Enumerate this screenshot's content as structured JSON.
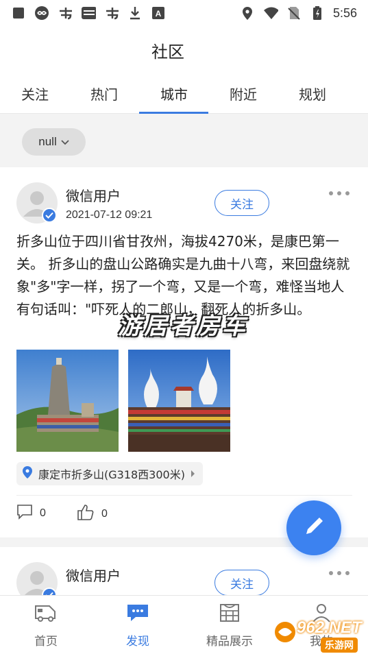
{
  "status_bar": {
    "time": "5:56",
    "left_icons": [
      "square-icon",
      "infinity-badge-icon",
      "app-icon",
      "news-app-icon",
      "app-icon",
      "download-icon",
      "text-a-icon"
    ],
    "right_icons": [
      "location-icon",
      "wifi-icon",
      "no-sim-icon",
      "battery-charging-icon"
    ]
  },
  "header": {
    "title": "社区"
  },
  "tabs": [
    {
      "label": "关注"
    },
    {
      "label": "热门"
    },
    {
      "label": "城市",
      "active": true
    },
    {
      "label": "附近"
    },
    {
      "label": "规划"
    }
  ],
  "filter": {
    "city_label": "null"
  },
  "posts": [
    {
      "username": "微信用户",
      "time": "2021-07-12 09:21",
      "follow_label": "关注",
      "text": "折多山位于四川省甘孜州，海拔4270米，是康巴第一关。 折多山的盘山公路确实是九曲十八弯，来回盘绕就象\"多\"字一样，拐了一个弯，又是一个弯，难怪当地人有句话叫：\"吓死人的二郎山，翻死人的折多山。",
      "location": "康定市折多山(G318西300米)",
      "comments": "0",
      "likes": "0"
    },
    {
      "username": "微信用户",
      "follow_label": "关注"
    }
  ],
  "watermark": "游居者房车",
  "bottom_nav": [
    {
      "label": "首页",
      "icon": "rv-icon"
    },
    {
      "label": "发现",
      "icon": "chat-bubble-icon",
      "active": true
    },
    {
      "label": "精品展示",
      "icon": "showcase-icon"
    },
    {
      "label": "我的",
      "icon": "user-icon"
    }
  ],
  "site_mark": {
    "main": "962.NET",
    "sub": "乐游网"
  },
  "colors": {
    "accent": "#3a7be0",
    "fab": "#3c82f0"
  }
}
